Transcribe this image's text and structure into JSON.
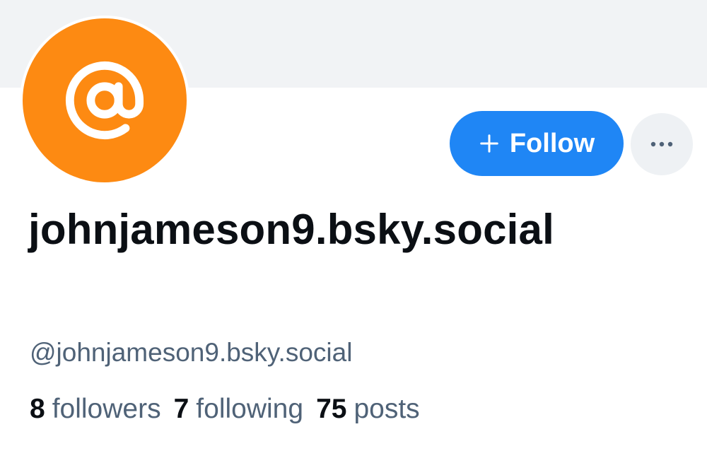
{
  "profile": {
    "display_name": "johnjameson9.bsky.social",
    "handle": "@johnjameson9.bsky.social",
    "avatar_icon": "at-sign-icon",
    "avatar_color": "#fd8a12",
    "banner_color": "#f1f3f5"
  },
  "actions": {
    "follow_label": "Follow",
    "follow_icon": "plus-icon",
    "follow_color": "#1f86f5",
    "more_icon": "ellipsis-icon"
  },
  "stats": [
    {
      "count": "8",
      "label": "followers"
    },
    {
      "count": "7",
      "label": "following"
    },
    {
      "count": "75",
      "label": "posts"
    }
  ]
}
